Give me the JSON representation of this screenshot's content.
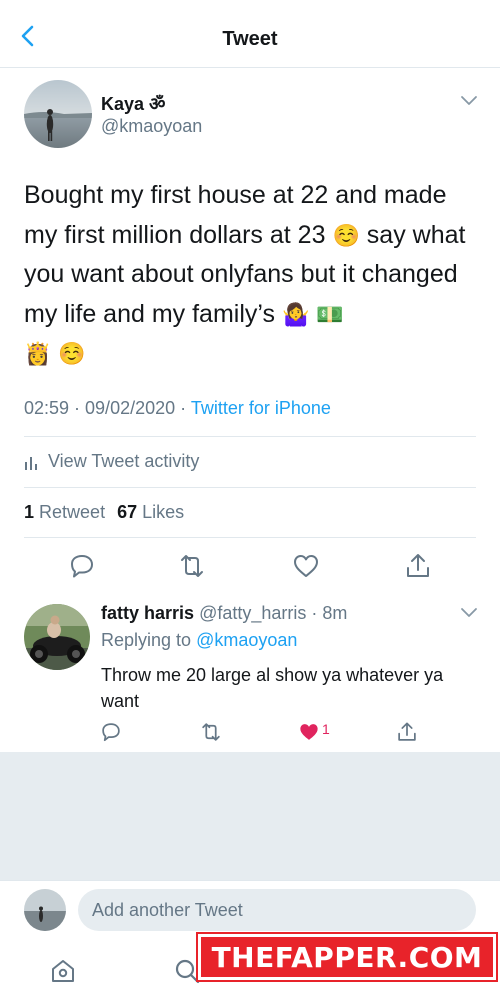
{
  "nav": {
    "title": "Tweet",
    "back_icon": "chevron-left-icon"
  },
  "tweet": {
    "name": "Kaya ॐ",
    "handle": "@kmaoyoan",
    "text_line1": "Bought my first house at 22 and made my first million dollars at 23",
    "text_line2": "say what you want about onlyfans but it changed my life and my family’s",
    "emoji_smile": "☺️",
    "emoji_shrug": "🤷‍♀️",
    "emoji_money": "💵",
    "emoji_princess": "👸",
    "time": "02:59 · 09/02/2020 · ",
    "source": "Twitter for iPhone",
    "activity_label": "View Tweet activity",
    "retweet_count": "1",
    "retweet_label": "Retweet",
    "like_count": "67",
    "like_label": "Likes"
  },
  "reply": {
    "name": "fatty harris",
    "handle": "@fatty_harris · 8m",
    "replying_prefix": "Replying to ",
    "replying_to": "@kmaoyoan",
    "text": "Throw me 20 large al show ya whatever ya want",
    "like_count": "1"
  },
  "composer": {
    "placeholder": "Add another Tweet"
  },
  "watermark": {
    "text": "THEFAPPER.COM"
  },
  "colors": {
    "accent": "#1da1f2",
    "muted": "#657786",
    "like": "#e0245e",
    "watermark": "#e8232a"
  }
}
